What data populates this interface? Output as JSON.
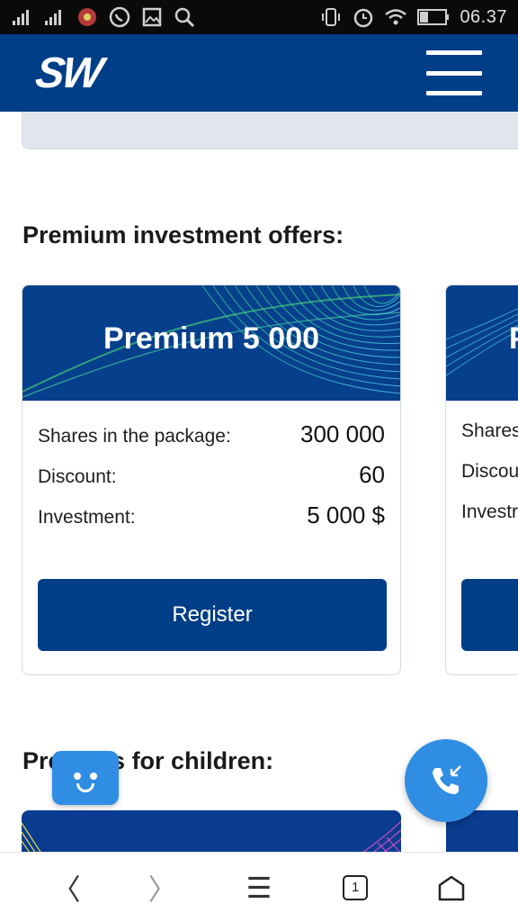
{
  "status_bar": {
    "time": "06.37",
    "left_icons": [
      "signal-icon",
      "signal-2-icon",
      "notification-icon",
      "whatsapp-icon",
      "gallery-icon",
      "search-icon"
    ],
    "right_icons": [
      "vibrate-icon",
      "alarm-icon",
      "wifi-icon",
      "battery-icon"
    ]
  },
  "header": {
    "logo": "SW",
    "menu_icon": "hamburger-menu-icon",
    "background": "#003e87"
  },
  "sections": {
    "premium_title": "Premium investment offers:",
    "children_title": "Presents for children:"
  },
  "cards": [
    {
      "title": "Premium 5 000",
      "rows": [
        {
          "label": "Shares in the package:",
          "value": "300 000"
        },
        {
          "label": "Discount:",
          "value": "60"
        },
        {
          "label": "Investment:",
          "value": "5 000 $"
        }
      ],
      "button": "Register"
    },
    {
      "title": "P",
      "rows": [
        {
          "label": "Shares",
          "value": ""
        },
        {
          "label": "Discou",
          "value": ""
        },
        {
          "label": "Investr",
          "value": ""
        }
      ],
      "button": ""
    }
  ],
  "widgets": {
    "chat_icon": "chat-face-icon",
    "call_icon": "phone-call-icon",
    "accent": "#2f8de4"
  },
  "bottom_nav": {
    "back": "〈",
    "forward": "〉",
    "menu": "☰",
    "tabs_count": "1",
    "home_icon": "home-icon"
  }
}
